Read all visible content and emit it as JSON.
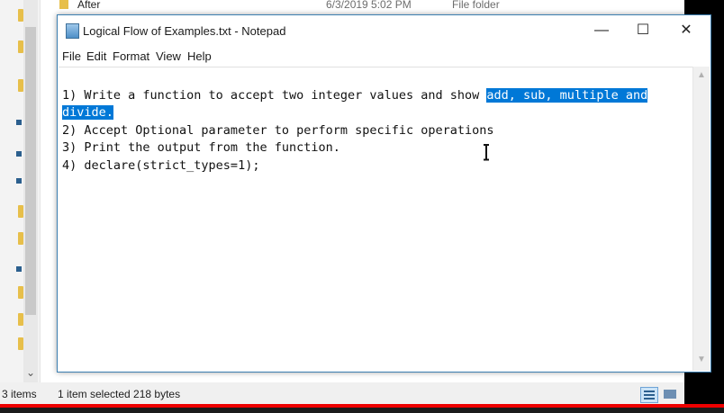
{
  "explorer": {
    "top_row": {
      "name": "After",
      "date": "6/3/2019 5:02 PM",
      "type": "File folder"
    },
    "status": {
      "items_count": "3 items",
      "selection": "1 item selected  218 bytes"
    },
    "scroll_down_icon": "chevron-down-icon",
    "view_buttons": [
      "details-view-icon",
      "tiles-view-icon"
    ]
  },
  "notepad": {
    "title": "Logical Flow of Examples.txt - Notepad",
    "window_buttons": {
      "minimize": "—",
      "maximize": "☐",
      "close": "✕"
    },
    "menu": [
      "File",
      "Edit",
      "Format",
      "View",
      "Help"
    ],
    "lines": [
      {
        "before": "1) Write a function to accept two integer values and show ",
        "selected": "add, sub, multiple and"
      },
      {
        "before": "",
        "selected": "divide."
      },
      {
        "before": "2) Accept Optional parameter to perform specific operations",
        "selected": ""
      },
      {
        "before": "3) Print the output from the function.",
        "selected": ""
      },
      {
        "before": "4) declare(strict_types=1);",
        "selected": ""
      }
    ],
    "scroll_up": "▲",
    "scroll_down": "▼"
  },
  "colors": {
    "selection": "#0078d7",
    "accent_border": "#3c7fb1",
    "folder": "#e7bf4a",
    "progress_red": "#e00000"
  }
}
